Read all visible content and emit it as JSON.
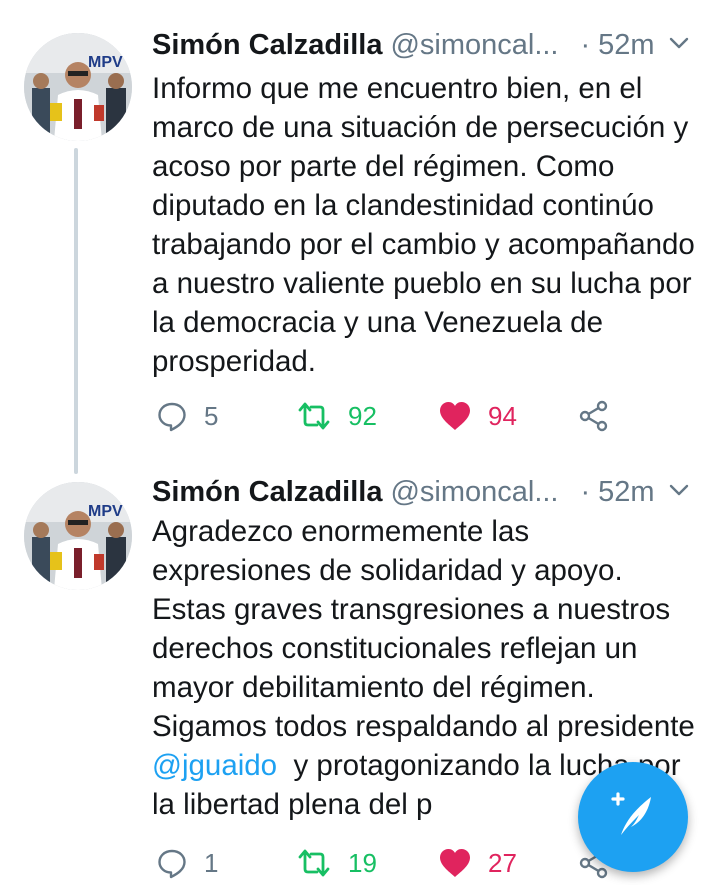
{
  "tweets": [
    {
      "author_name": "Simón Calzadilla",
      "handle": "@simoncal...",
      "separator": "·",
      "time": "52m",
      "text_segments": [
        "Informo que me encuentro bien, en el marco de una situación de persecución y acoso por parte del régimen. Como diputado en la clandestinidad continúo trabajando por el cambio y acompañando a nuestro valiente pueblo en su lucha por la democracia y una Venezuela de prosperidad."
      ],
      "replies": "5",
      "retweets": "92",
      "likes": "94",
      "liked": true
    },
    {
      "author_name": "Simón Calzadilla",
      "handle": "@simoncal...",
      "separator": "·",
      "time": "52m",
      "text_before": "Agradezco enormemente las expresiones de solidaridad y apoyo. Estas graves transgresiones a nuestros derechos constitucionales reflejan un mayor debilitamiento del régimen. Sigamos todos respaldando al presidente ",
      "mention": "@jguaido",
      "text_after": "  y protagonizando la lucha por la libertad plena del p",
      "replies": "1",
      "retweets": "19",
      "likes": "27",
      "liked": true
    }
  ],
  "colors": {
    "accent": "#1da1f2",
    "retweet": "#17bf63",
    "like": "#e0245e",
    "muted": "#657786",
    "thread_line": "#ccd6dd"
  },
  "icons": {
    "reply": "reply-bubble-icon",
    "retweet": "retweet-arrows-icon",
    "like": "heart-icon",
    "share": "share-icon",
    "caret": "chevron-down-icon",
    "compose": "compose-feather-icon"
  }
}
